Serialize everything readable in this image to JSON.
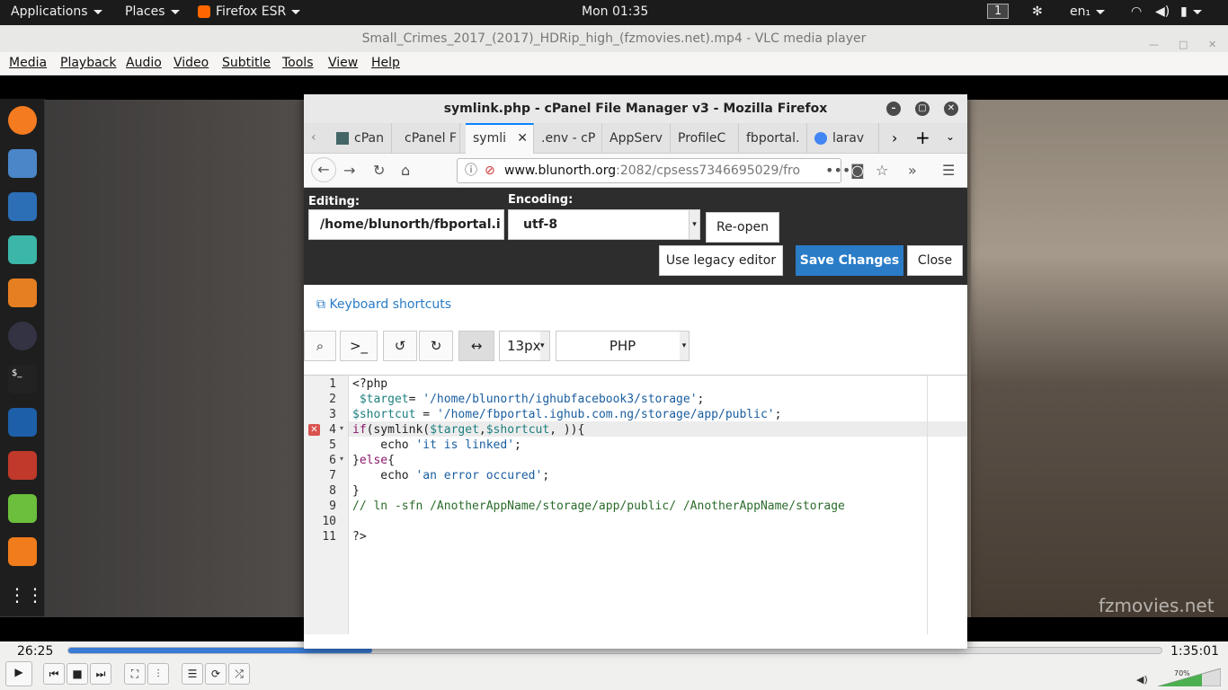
{
  "topbar": {
    "applications": "Applications",
    "places": "Places",
    "firefox": "Firefox ESR",
    "clock": "Mon 01:35",
    "workspace": "1",
    "lang": "en₁"
  },
  "vlc": {
    "title": "Small_Crimes_2017_(2017)_HDRip_high_(fzmovies.net).mp4 - VLC media player",
    "menu": [
      "Media",
      "Playback",
      "Audio",
      "Video",
      "Subtitle",
      "Tools",
      "View",
      "Help"
    ],
    "watermark": "fzmovies.net",
    "elapsed": "26:25",
    "total": "1:35:01",
    "volume": "70%",
    "progress_fraction": 0.278,
    "volume_fraction": 0.7
  },
  "firefox": {
    "title": "symlink.php - cPanel File Manager v3 - Mozilla Firefox",
    "tabs": [
      "cPan",
      "cPanel F",
      "symli",
      ".env - cP",
      "AppServ",
      "ProfileC",
      "fbportal.",
      "larav"
    ],
    "url_domain": "www.blunorth.org",
    "url_rest": ":2082/cpsess7346695029/fro"
  },
  "editor": {
    "editing_label": "Editing:",
    "path": "/home/blunorth/fbportal.i",
    "encoding_label": "Encoding:",
    "encoding": "utf-8",
    "reopen": "Re-open",
    "legacy": "Use legacy editor",
    "save": "Save Changes",
    "close": "Close",
    "kb_shortcuts": "Keyboard shortcuts",
    "font_size": "13px",
    "mode": "PHP",
    "lines": [
      "1",
      "2",
      "3",
      "4",
      "5",
      "6",
      "7",
      "8",
      "9",
      "10",
      "11"
    ]
  }
}
